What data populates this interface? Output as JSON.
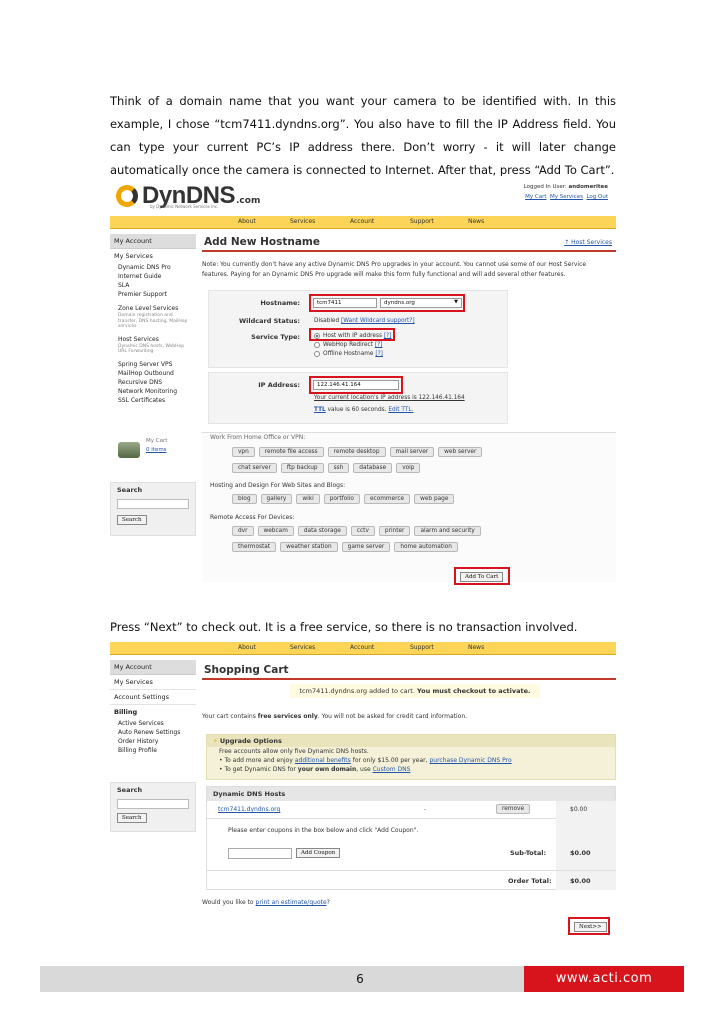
{
  "paragraphs": {
    "p1": "Think of a domain name that you want your camera to be identified with. In this example, I chose “tcm7411.dyndns.org”. You also have to fill the IP Address field. You can type your current PC’s IP address there. Don’t worry - it will later change automatically once the camera is connected to Internet. After that, press “Add To Cart”.",
    "p2": "Press “Next” to check out. It is a free service, so there is no transaction involved."
  },
  "shot1": {
    "logo": {
      "word": "DynDNS",
      "com": ".com",
      "tag": "by Dynamic Network Services Inc."
    },
    "user": {
      "logged_label": "Logged In User:",
      "username": "andomeritee",
      "links": [
        "My Cart",
        "My Services",
        "Log Out"
      ]
    },
    "nav": [
      "About",
      "Services",
      "Account",
      "Support",
      "News"
    ],
    "sidebar": {
      "head": "My Account",
      "section": "My Services",
      "items_a": [
        "Dynamic DNS Pro",
        "Internet Guide",
        "SLA",
        "Premier Support"
      ],
      "zone_title": "Zone Level Services",
      "zone_desc": "Domain registration and transfer, DNS hosting, MailHop services",
      "host_title": "Host Services",
      "host_desc": "Dynamic DNS hosts, WebHop URL Forwarding",
      "items_b": [
        "Spring Server VPS",
        "MailHop Outbound",
        "Recursive DNS",
        "Network Monitoring",
        "SSL Certificates"
      ],
      "cart_label": "My Cart",
      "cart_items": "0 items",
      "search_label": "Search",
      "search_button": "Search"
    },
    "title": "Add New Hostname",
    "title_link": "↑ Host Services",
    "note": "Note: You currently don't have any active Dynamic DNS Pro upgrades in your account. You cannot use some of our Host Service features. Paying for an Dynamic DNS Pro upgrade will make this form fully functional and will add several other features.",
    "note_link": "Dynamic DNS Pro upgrades",
    "hostname_label": "Hostname:",
    "hostname_value": "tcm7411",
    "domain_value": "dyndns.org",
    "wildcard_label": "Wildcard Status:",
    "wildcard_value": "Disabled",
    "wildcard_link": "[Want Wildcard support?]",
    "service_label": "Service Type:",
    "service_options": [
      "Host with IP address",
      "WebHop Redirect",
      "Offline Hostname"
    ],
    "help": "[?]",
    "ip_label": "IP Address:",
    "ip_value": "122.146.41.164",
    "ip_hint": "Your current location's IP address is 122.146.41.164",
    "ttl_text": "value is 60 seconds.",
    "ttl_link": "TTL",
    "ttl_edit": "Edit TTL.",
    "group0_label": "Work From Home Office or VPN:",
    "group0_tags": [
      "vpn",
      "remote file access",
      "remote desktop",
      "mail server",
      "web server",
      "chat server",
      "ftp backup",
      "ssh",
      "database",
      "voip"
    ],
    "group1_label": "Hosting and Design For Web Sites and Blogs:",
    "group1_tags": [
      "blog",
      "gallery",
      "wiki",
      "portfolio",
      "ecommerce",
      "web page"
    ],
    "group2_label": "Remote Access For Devices:",
    "group2_tags": [
      "dvr",
      "webcam",
      "data storage",
      "cctv",
      "printer",
      "alarm and security",
      "thermostat",
      "weather station",
      "game server",
      "home automation"
    ],
    "add_to_cart": "Add To Cart"
  },
  "shot2": {
    "nav": [
      "About",
      "Services",
      "Account",
      "Support",
      "News"
    ],
    "sidebar": {
      "head": "My Account",
      "items": [
        "My Services",
        "Account Settings",
        "Billing"
      ],
      "billing_items": [
        "Active Services",
        "Auto Renew Settings",
        "Order History",
        "Billing Profile"
      ],
      "search_label": "Search",
      "search_button": "Search"
    },
    "title": "Shopping Cart",
    "added_host": "tcm7411.dyndns.org added to cart.",
    "added_must": "You must checkout to activate.",
    "free_pre": "Your cart contains",
    "free_bold": "free services only",
    "free_post": ". You will not be asked for credit card information.",
    "upgrade_head": "Upgrade Options",
    "upgrade_line1": "Free accounts allow only five Dynamic DNS hosts.",
    "upgrade_line2_pre": "• To add more and enjoy",
    "upgrade_line2_link": "additional benefits",
    "upgrade_line2_mid": "for only $15.00 per year,",
    "upgrade_line2_link2": "purchase Dynamic DNS Pro",
    "upgrade_line3_pre": "• To get Dynamic DNS for",
    "upgrade_line3_bold": "your own domain",
    "upgrade_line3_mid": ", use",
    "upgrade_line3_link": "Custom DNS",
    "hosts_head": "Dynamic DNS Hosts",
    "host_name": "tcm7411.dyndns.org",
    "host_dash": "-",
    "remove": "remove",
    "price": "$0.00",
    "coupon_text": "Please enter coupons in the box below and click \"Add Coupon\".",
    "add_coupon": "Add Coupon",
    "subtotal_label": "Sub-Total:",
    "subtotal": "$0.00",
    "order_label": "Order Total:",
    "order_total": "$0.00",
    "estimate_pre": "Would you like to",
    "estimate_link": "print an estimate/quote",
    "estimate_post": "?",
    "next": "Next>>"
  },
  "footer": {
    "page": "6",
    "site": "www.acti.com"
  },
  "colors": {
    "accent_red": "#d7131b",
    "nav_yellow": "#fbd458",
    "link_blue": "#2255aa"
  }
}
